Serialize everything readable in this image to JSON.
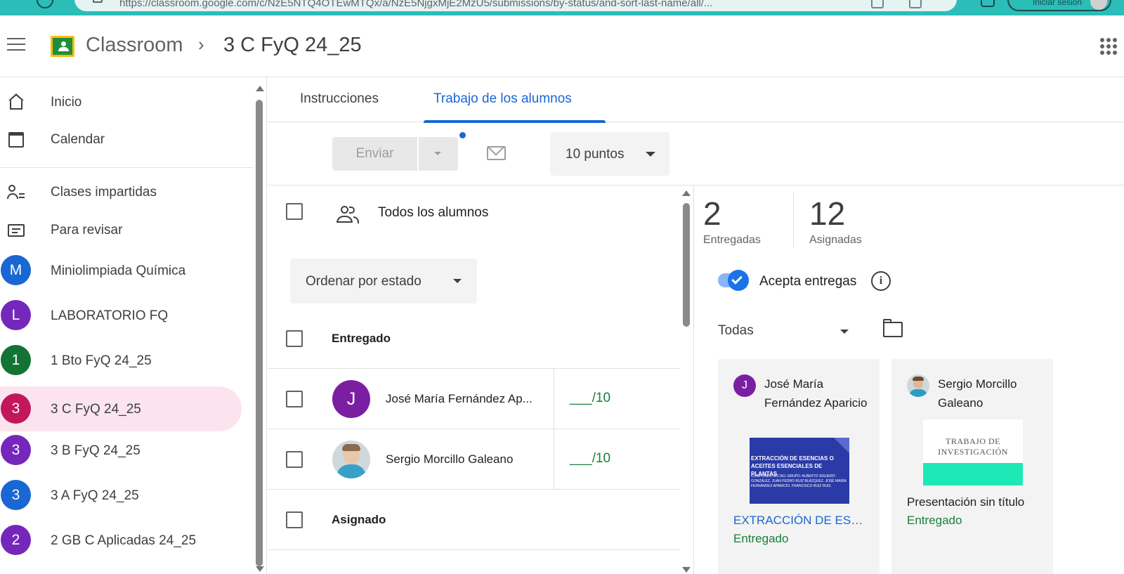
{
  "browser": {
    "url": "https://classroom.google.com/c/NzE5NTQ4OTEwMTQx/a/NzE5NjgxMjE2MzU5/submissions/by-status/and-sort-last-name/all/...",
    "login_label": "Iniciar sesión"
  },
  "header": {
    "app_name": "Classroom",
    "breadcrumb_separator": "›",
    "class_name": "3 C FyQ 24_25"
  },
  "sidebar": {
    "items": [
      {
        "label": "Inicio",
        "icon": "home-icon"
      },
      {
        "label": "Calendar",
        "icon": "calendar-icon"
      },
      {
        "label": "Clases impartidas",
        "icon": "people-icon"
      },
      {
        "label": "Para revisar",
        "icon": "review-icon"
      },
      {
        "label": "Miniolimpiada Química",
        "initial": "M",
        "color": "#1967d2"
      },
      {
        "label": "LABORATORIO FQ",
        "initial": "L",
        "color": "#7627bb"
      },
      {
        "label": "1 Bto FyQ 24_25",
        "initial": "1",
        "color": "#137333"
      },
      {
        "label": "3 C FyQ 24_25",
        "initial": "3",
        "color": "#c2185b",
        "selected": true
      },
      {
        "label": "3 B FyQ 24_25",
        "initial": "3",
        "color": "#7627bb"
      },
      {
        "label": "3 A FyQ 24_25",
        "initial": "3",
        "color": "#1967d2"
      },
      {
        "label": "2 GB C Aplicadas 24_25",
        "initial": "2",
        "color": "#7627bb"
      }
    ],
    "selected_bg": "#fce4ef"
  },
  "tabs": [
    {
      "label": "Instrucciones",
      "active": false
    },
    {
      "label": "Trabajo de los alumnos",
      "active": true
    }
  ],
  "toolbar": {
    "send_label": "Enviar",
    "points_label": "10 puntos"
  },
  "list": {
    "all_students_label": "Todos los alumnos",
    "sort_label": "Ordenar por estado",
    "sections": [
      {
        "label": "Entregado",
        "students": [
          {
            "name": "José María Fernández Ap...",
            "initial": "J",
            "avatar_color": "#7b1fa2",
            "grade": "___/10"
          },
          {
            "name": "Sergio Morcillo Galeano",
            "initial": "",
            "avatar_color": "#cfd8dc",
            "grade": "___/10"
          }
        ]
      },
      {
        "label": "Asignado",
        "students": []
      }
    ]
  },
  "summary": {
    "turned_in_count": "2",
    "turned_in_label": "Entregadas",
    "assigned_count": "12",
    "assigned_label": "Asignadas",
    "accept_label": "Acepta entregas",
    "accepting": true,
    "filter_label": "Todas"
  },
  "cards": [
    {
      "student_name": "José María Fernández Aparicio",
      "initial": "J",
      "avatar_color": "#7b1fa2",
      "thumb_title": "EXTRACCIÓN DE ESENCIAS O ACEITES ESENCIALES DE PLANTAS",
      "thumb_body": "COMPONENTES DEL GRUPO: ALBERTO SIGUERO GONZÁLEZ. JUAN PEDRO RUIZ BLÁZQUEZ. JOSÉ MARÍA FERNÁNDEZ APARICIO. FRANCISCO RUIZ RUIZ.",
      "file_title": "EXTRACCIÓN DE ESE...",
      "file_title_color": "#1967d2",
      "status": "Entregado"
    },
    {
      "student_name": "Sergio Morcillo Galeano",
      "initial": "",
      "avatar_color": "#cfd8dc",
      "thumb_title": "TRABAJO DE INVESTIGACIÓN",
      "file_title": "Presentación sin título",
      "file_title_color": "#202124",
      "status": "Entregado"
    }
  ],
  "colors": {
    "accent": "#1967d2",
    "green": "#188038",
    "browser_teal": "#2bbdb8"
  }
}
